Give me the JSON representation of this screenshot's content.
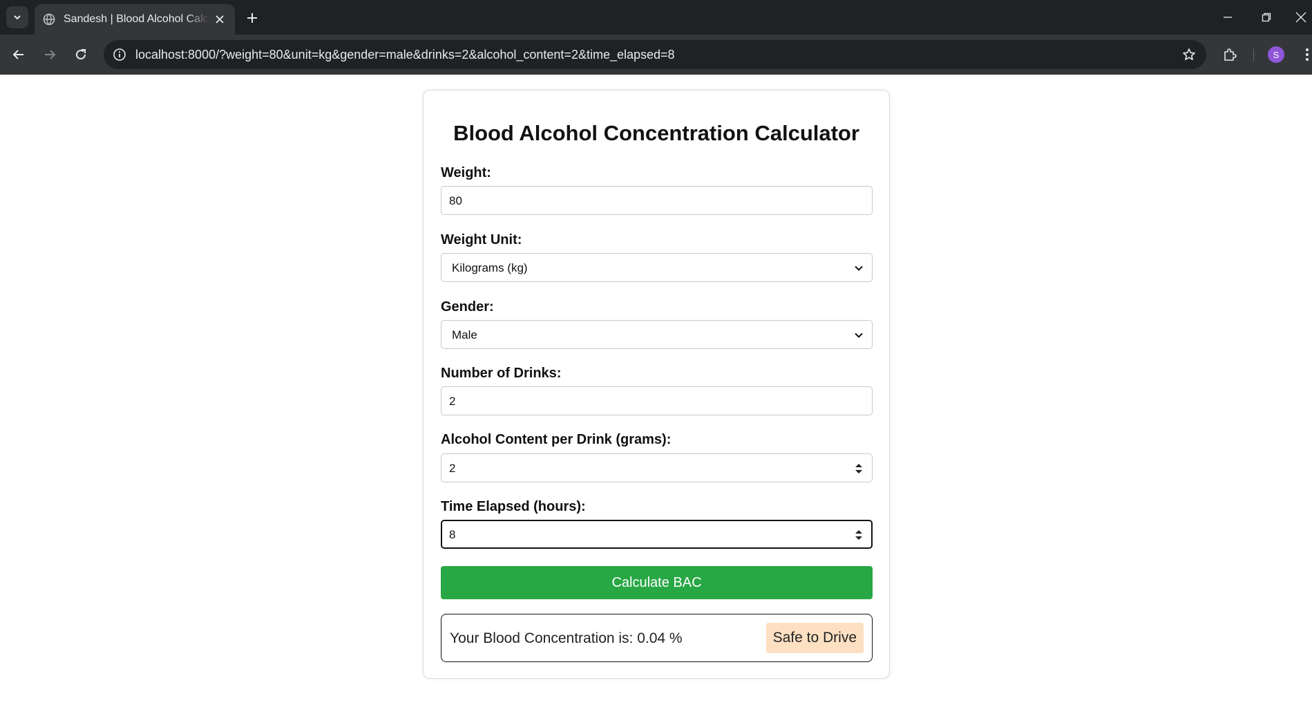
{
  "browser": {
    "tab_title": "Sandesh | Blood Alcohol Calculator",
    "url": "localhost:8000/?weight=80&unit=kg&gender=male&drinks=2&alcohol_content=2&time_elapsed=8",
    "profile_initial": "S",
    "icons": [
      "tab-search-icon",
      "globe-icon",
      "close-icon",
      "plus-icon",
      "minimize-icon",
      "restore-icon",
      "close-window-icon",
      "back-icon",
      "forward-icon",
      "reload-icon",
      "info-icon",
      "star-icon",
      "extensions-icon",
      "kebab-menu-icon"
    ]
  },
  "form": {
    "title": "Blood Alcohol Concentration Calculator",
    "weight": {
      "label": "Weight:",
      "value": "80"
    },
    "weight_unit": {
      "label": "Weight Unit:",
      "selected": "Kilograms (kg)"
    },
    "gender": {
      "label": "Gender:",
      "selected": "Male"
    },
    "drinks": {
      "label": "Number of Drinks:",
      "value": "2"
    },
    "alcohol_content": {
      "label": "Alcohol Content per Drink (grams):",
      "value": "2"
    },
    "time_elapsed": {
      "label": "Time Elapsed (hours):",
      "value": "8"
    },
    "submit_label": "Calculate BAC"
  },
  "result": {
    "text": "Your Blood Concentration is: 0.04 %",
    "status": "Safe to Drive"
  },
  "colors": {
    "button": "#28a745",
    "status_badge": "#fde0c2",
    "chrome_dark": "#202124",
    "chrome_toolbar": "#35363a",
    "avatar": "#8f57d8"
  }
}
